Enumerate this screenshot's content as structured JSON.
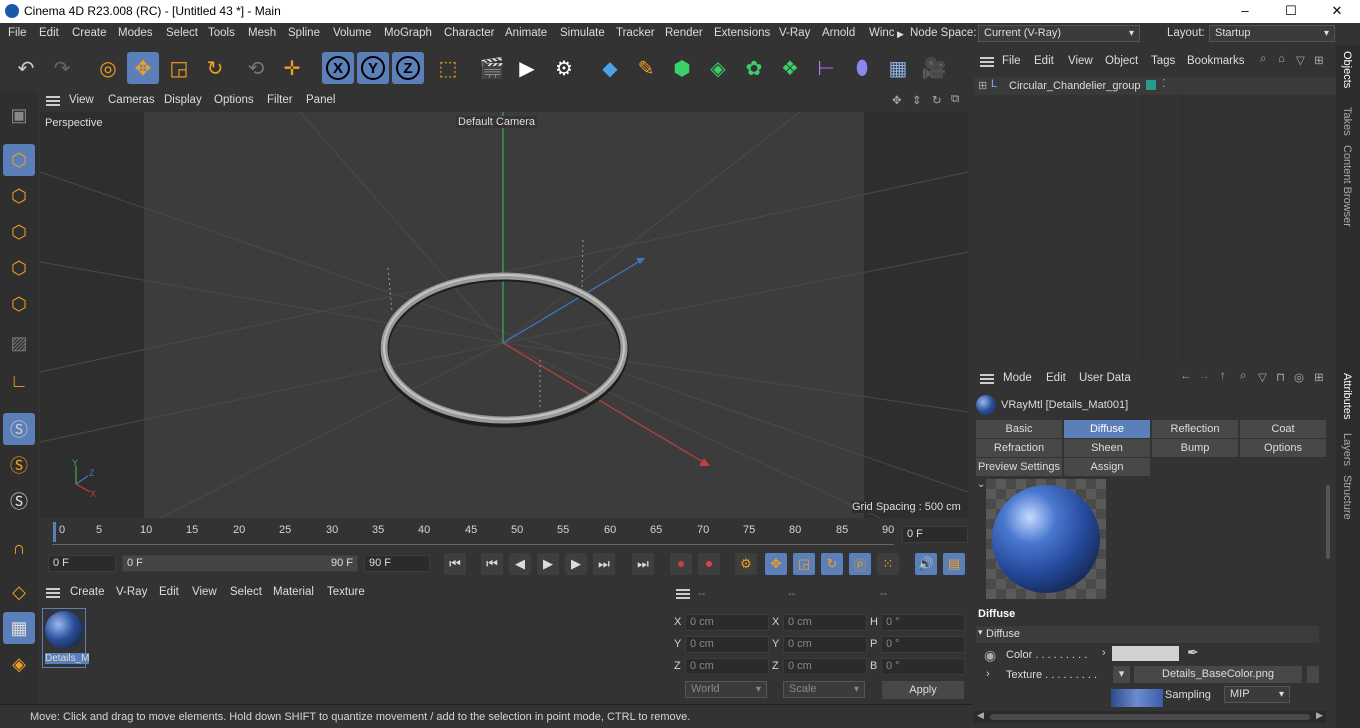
{
  "window": {
    "title": "Cinema 4D R23.008 (RC) - [Untitled 43 *] - Main",
    "minimize": "–",
    "maximize": "☐",
    "close": "✕"
  },
  "menubar": {
    "items": [
      "File",
      "Edit",
      "Create",
      "Modes",
      "Select",
      "Tools",
      "Mesh",
      "Spline",
      "Volume",
      "MoGraph",
      "Character",
      "Animate",
      "Simulate",
      "Tracker",
      "Render",
      "Extensions",
      "V-Ray",
      "Arnold",
      "Winc"
    ],
    "node_space_label": "Node Space:",
    "node_space_value": "Current (V-Ray)",
    "layout_label": "Layout:",
    "layout_value": "Startup"
  },
  "toolbar": {
    "axis_x": "X",
    "axis_y": "Y",
    "axis_z": "Z"
  },
  "viewport_menu": [
    "View",
    "Cameras",
    "Display",
    "Options",
    "Filter",
    "Panel"
  ],
  "viewport": {
    "view_name": "Perspective",
    "camera": "Default Camera",
    "grid_spacing": "Grid Spacing : 500 cm",
    "axis_x": "X",
    "axis_y": "Y",
    "axis_z": "Z"
  },
  "timeline": {
    "ticks": [
      "0",
      "5",
      "10",
      "15",
      "20",
      "25",
      "30",
      "35",
      "40",
      "45",
      "50",
      "55",
      "60",
      "65",
      "70",
      "75",
      "80",
      "85",
      "90"
    ],
    "current_frame": "0 F"
  },
  "transport": {
    "start": "0 F",
    "range_start": "0 F",
    "range_end": "90 F",
    "end": "90 F"
  },
  "material_manager": {
    "menu": [
      "Create",
      "V-Ray",
      "Edit",
      "View",
      "Select",
      "Material",
      "Texture"
    ],
    "material_name": "Details_M"
  },
  "coordinates": {
    "header": [
      "--",
      "--",
      "--"
    ],
    "rows": [
      {
        "a": "X",
        "av": "0 cm",
        "b": "X",
        "bv": "0 cm",
        "c": "H",
        "cv": "0 °"
      },
      {
        "a": "Y",
        "av": "0 cm",
        "b": "Y",
        "bv": "0 cm",
        "c": "P",
        "cv": "0 °"
      },
      {
        "a": "Z",
        "av": "0 cm",
        "b": "Z",
        "bv": "0 cm",
        "c": "B",
        "cv": "0 °"
      }
    ],
    "mode1": "World",
    "mode2": "Scale",
    "apply": "Apply"
  },
  "status": "Move: Click and drag to move elements. Hold down SHIFT to quantize movement / add to the selection in point mode, CTRL to remove.",
  "objects": {
    "menu": [
      "File",
      "Edit",
      "View",
      "Object",
      "Tags",
      "Bookmarks"
    ],
    "items": [
      {
        "name": "Circular_Chandelier_group"
      }
    ]
  },
  "attributes": {
    "menu": [
      "Mode",
      "Edit",
      "User Data"
    ],
    "material_title": "VRayMtl [Details_Mat001]",
    "tabs_row1": [
      "Basic",
      "Diffuse",
      "Reflection",
      "Coat"
    ],
    "tabs_row2": [
      "Refraction",
      "Sheen",
      "Bump",
      "Options"
    ],
    "tabs_row3": [
      "Preview Settings",
      "Assign"
    ],
    "section": "Diffuse",
    "group": "Diffuse",
    "color_label": "Color . . . . . . . . .",
    "texture_label": "Texture . . . . . . . . .",
    "texture_file": "Details_BaseColor.png",
    "sampling_label": "Sampling",
    "sampling_value": "MIP"
  },
  "side_tabs": [
    "Objects",
    "Takes",
    "Content Browser",
    "Attributes",
    "Layers",
    "Structure"
  ],
  "colors": {
    "accent": "#5b7fb8",
    "background": "#333333",
    "viewport": "#3a3a3a"
  }
}
